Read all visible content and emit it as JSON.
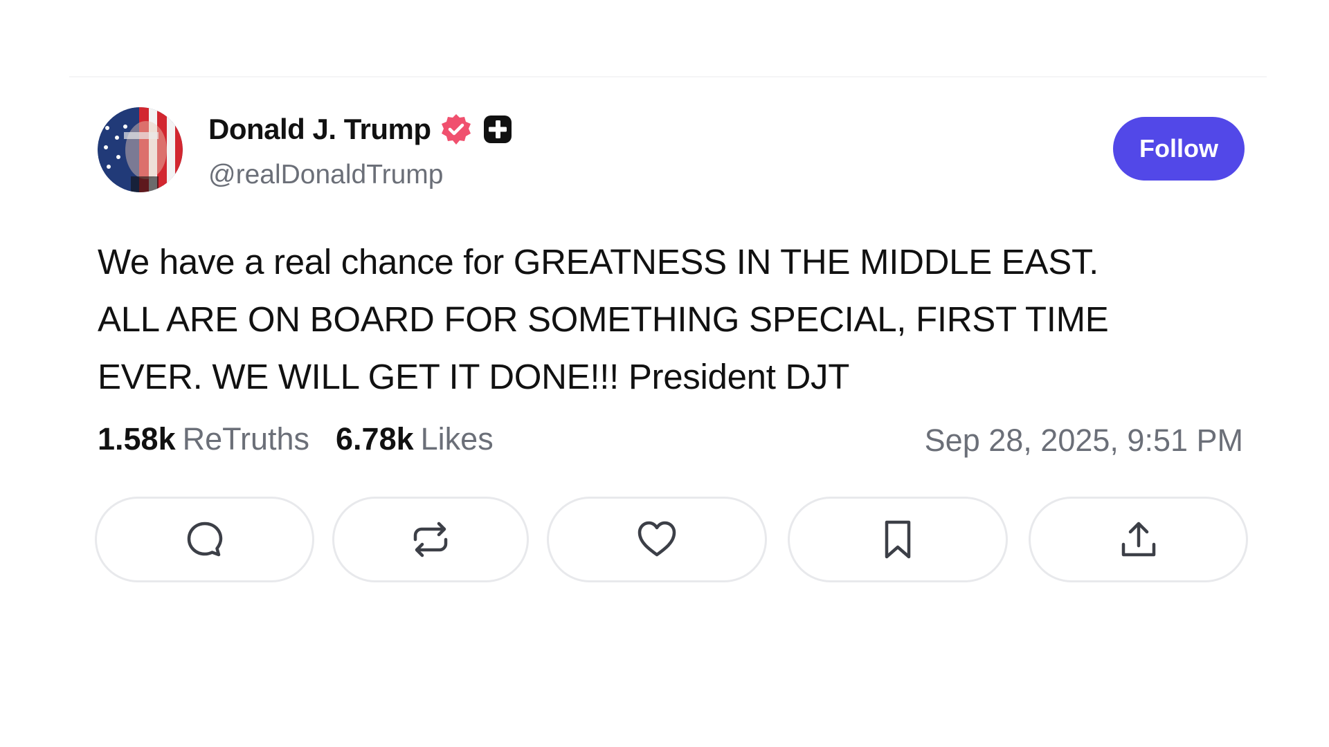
{
  "post": {
    "author_name": "Donald J. Trump",
    "author_handle": "@realDonaldTrump",
    "follow_label": "Follow",
    "body_lines": [
      "We have a real chance for GREATNESS IN THE MIDDLE EAST.",
      "ALL ARE ON BOARD FOR SOMETHING SPECIAL, FIRST TIME",
      "EVER. WE WILL GET IT DONE!!! President DJT"
    ],
    "retruths_count": "1.58k",
    "retruths_label": "ReTruths",
    "likes_count": "6.78k",
    "likes_label": "Likes",
    "timestamp": "Sep 28, 2025, 9:51 PM"
  },
  "icons": {
    "verified": "verified-badge-icon",
    "plus": "plus-badge-icon",
    "reply": "reply-icon",
    "retruth": "retruth-icon",
    "like": "heart-icon",
    "bookmark": "bookmark-icon",
    "share": "share-icon"
  },
  "colors": {
    "accent": "#5248e8",
    "verified": "#f0506e",
    "muted_text": "#6b6f78",
    "button_border": "#e8e9ec"
  }
}
